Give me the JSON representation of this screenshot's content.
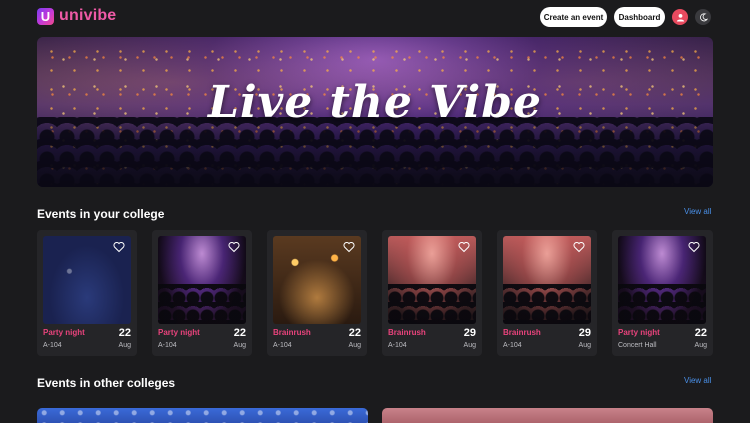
{
  "header": {
    "logo_letter": "U",
    "brand": "univibe",
    "create_label": "Create an event",
    "dashboard_label": "Dashboard",
    "accent": "#ee5aa6"
  },
  "hero": {
    "title": "Live the Vibe"
  },
  "sections": {
    "college": {
      "title": "Events in your college",
      "view_all": "View all"
    },
    "other": {
      "title": "Events in other colleges",
      "view_all": "View all"
    }
  },
  "events": [
    {
      "name": "Party night",
      "day": "22",
      "month": "Aug",
      "venue": "A-104"
    },
    {
      "name": "Party night",
      "day": "22",
      "month": "Aug",
      "venue": "A-104"
    },
    {
      "name": "Brainrush",
      "day": "22",
      "month": "Aug",
      "venue": "A-104"
    },
    {
      "name": "Brainrush",
      "day": "29",
      "month": "Aug",
      "venue": "A-104"
    },
    {
      "name": "Brainrush",
      "day": "29",
      "month": "Aug",
      "venue": "A-104"
    },
    {
      "name": "Party night",
      "day": "22",
      "month": "Aug",
      "venue": "Concert Hall"
    }
  ],
  "icons": {
    "avatar": "user-icon",
    "theme": "moon-icon",
    "heart": "heart-icon"
  },
  "colors": {
    "event_name": "#e8437c",
    "view_all": "#4a90e8",
    "avatar": "#e84a5f"
  }
}
